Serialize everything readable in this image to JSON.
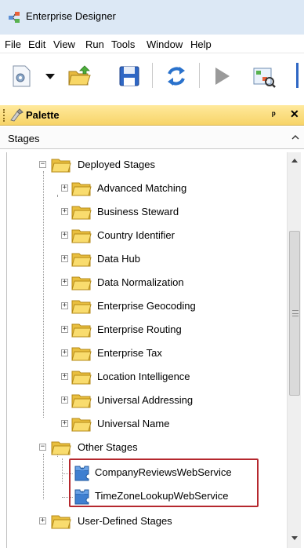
{
  "window": {
    "title": "Enterprise Designer"
  },
  "menu": [
    {
      "label": "File"
    },
    {
      "label": "Edit"
    },
    {
      "label": "View"
    },
    {
      "label": "Run"
    },
    {
      "label": "Tools"
    },
    {
      "label": "Window"
    },
    {
      "label": "Help"
    }
  ],
  "toolbar": {
    "icons": [
      "new-flow-icon",
      "dropdown-arrow-icon",
      "open-folder-icon",
      "save-icon",
      "refresh-icon",
      "run-icon",
      "inspect-icon"
    ]
  },
  "palette": {
    "title": "Palette",
    "pin_glyph": "ᵖ",
    "close_glyph": "✕"
  },
  "stages": {
    "label": "Stages"
  },
  "tree": {
    "deployed": {
      "label": "Deployed Stages"
    },
    "deployed_children": [
      {
        "label": "Advanced Matching"
      },
      {
        "label": "Business Steward"
      },
      {
        "label": "Country Identifier"
      },
      {
        "label": "Data Hub"
      },
      {
        "label": "Data Normalization"
      },
      {
        "label": "Enterprise Geocoding"
      },
      {
        "label": "Enterprise Routing"
      },
      {
        "label": "Enterprise Tax"
      },
      {
        "label": "Location Intelligence"
      },
      {
        "label": "Universal Addressing"
      },
      {
        "label": "Universal Name"
      }
    ],
    "other": {
      "label": "Other Stages"
    },
    "other_children": [
      {
        "label": "CompanyReviewsWebService"
      },
      {
        "label": "TimeZoneLookupWebService"
      }
    ],
    "user_defined": {
      "label": "User-Defined Stages"
    }
  },
  "colors": {
    "titlebar": "#dce8f5",
    "palette_header": "#f7d468",
    "highlight": "#b5282e",
    "folder": "#f6d35c",
    "service_icon": "#3f7fd0"
  }
}
